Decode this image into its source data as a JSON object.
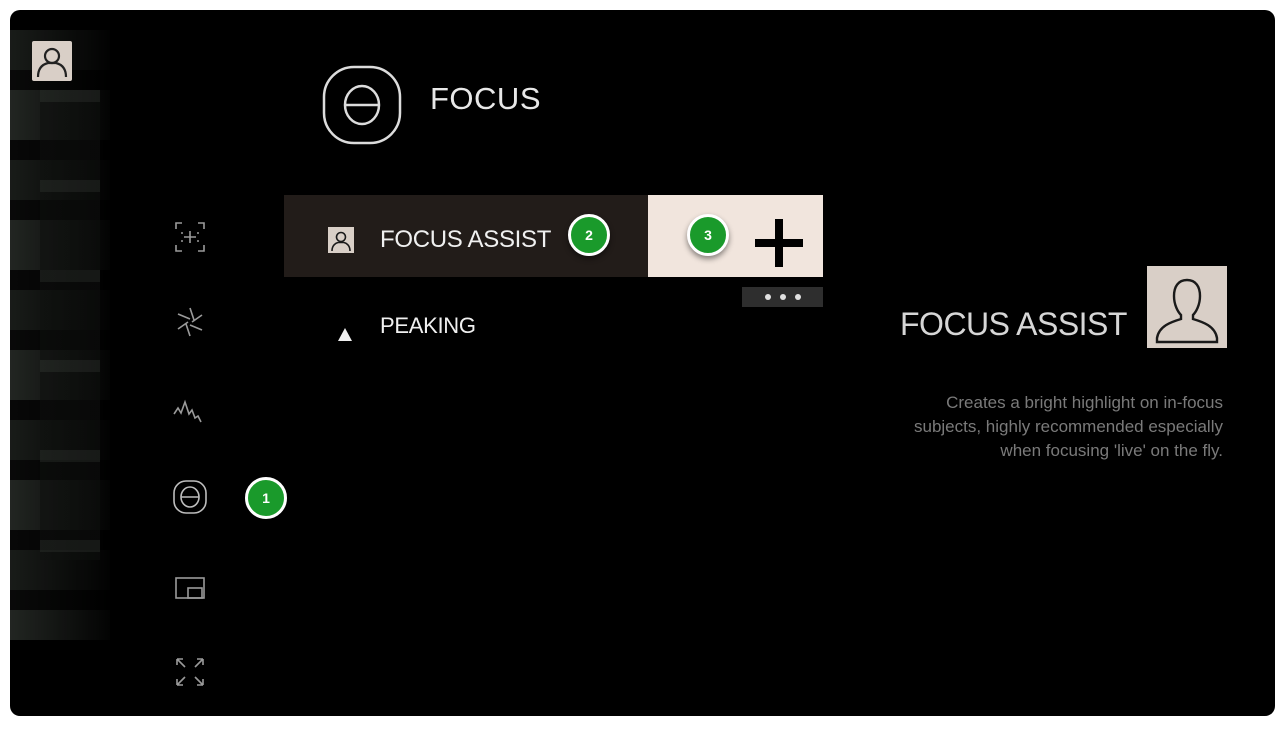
{
  "header": {
    "title": "FOCUS",
    "icon": "focus-theta-icon"
  },
  "sidebar": {
    "items": [
      {
        "name": "focus-frame-icon",
        "selected": false
      },
      {
        "name": "aperture-icon",
        "selected": false
      },
      {
        "name": "waveform-icon",
        "selected": false
      },
      {
        "name": "focus-theta-icon",
        "selected": true
      },
      {
        "name": "overlay-window-icon",
        "selected": false
      },
      {
        "name": "expand-icon",
        "selected": false
      }
    ]
  },
  "menu": {
    "items": [
      {
        "label": "FOCUS ASSIST",
        "icon": "person-silhouette-icon",
        "selected": true
      },
      {
        "label": "PEAKING",
        "icon": "triangle-up-icon",
        "selected": false
      }
    ],
    "add_symbol": "+",
    "more_icon": "more-dots-icon"
  },
  "badges": {
    "one": "1",
    "two": "2",
    "three": "3"
  },
  "detail": {
    "title": "FOCUS ASSIST",
    "description": "Creates a bright highlight on in-focus subjects, highly recommended especially when focusing 'live' on the fly."
  },
  "colors": {
    "background": "#000000",
    "selected_row": "#221c19",
    "add_panel": "#f1e5dd",
    "badge": "#1a9a2b",
    "text": "#f0f0f0",
    "muted_text": "#7a7a7a"
  }
}
